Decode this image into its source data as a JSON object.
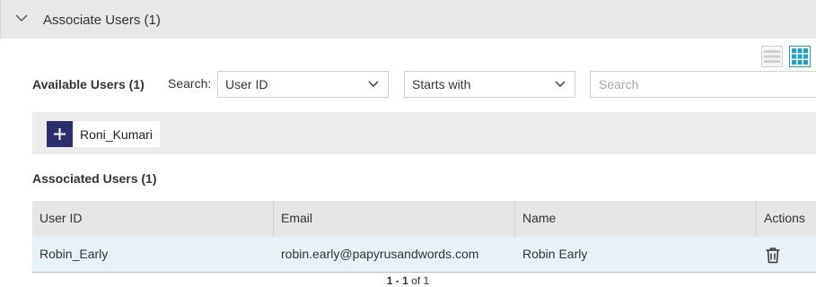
{
  "panel": {
    "title": "Associate Users (1)"
  },
  "available": {
    "heading": "Available Users (1)",
    "search_label": "Search:",
    "field_select": "User ID",
    "match_select": "Starts with",
    "search_placeholder": "Search",
    "users": [
      "Roni_Kumari"
    ]
  },
  "associated": {
    "heading": "Associated Users (1)",
    "columns": [
      "User ID",
      "Email",
      "Name",
      "Actions"
    ],
    "rows": [
      {
        "user_id": "Robin_Early",
        "email": "robin.early@papyrusandwords.com",
        "name": "Robin Early"
      }
    ]
  },
  "pager": {
    "from": "1",
    "sep": " - ",
    "to": "1",
    "of_word": " of ",
    "total": "1"
  },
  "icons": {
    "collapse": "chevron-down-icon",
    "list_view": "list-view-icon",
    "grid_view": "grid-view-icon",
    "add": "plus-icon",
    "delete": "trash-icon"
  },
  "colors": {
    "accent": "#1aa3c9",
    "add_button": "#2b2f6e",
    "row_highlight": "#e6f2f8"
  }
}
